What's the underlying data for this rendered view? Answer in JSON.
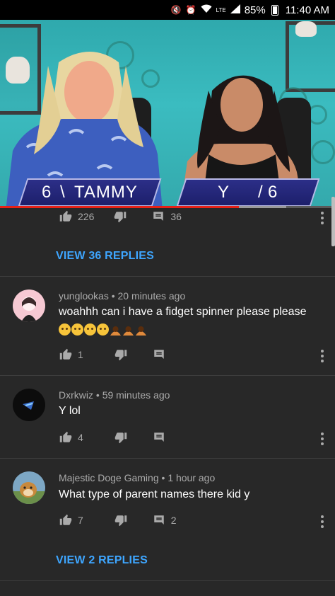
{
  "status_bar": {
    "battery": "85%",
    "time": "11:40 AM",
    "icons": [
      "mute-icon",
      "alarm-icon",
      "wifi-icon",
      "lte-icon",
      "signal-icon",
      "battery-icon"
    ]
  },
  "video": {
    "left_tag": {
      "score": "6",
      "name": "TAMMY"
    },
    "right_tag": {
      "name": "Y",
      "score": "6"
    },
    "progress": 0.713,
    "buffered": 0.854
  },
  "top_actions": {
    "likes": "226",
    "replies": "36"
  },
  "view_replies_1": "VIEW 36 REPLIES",
  "comments": [
    {
      "author": "yunglookas",
      "time": "20 minutes ago",
      "text": "woahhh can i have a fidget spinner please please",
      "emoji": [
        "pleading-face",
        "pleading-face",
        "pleading-face",
        "pleading-face",
        "person-bowing",
        "person-bowing",
        "person-bowing"
      ],
      "likes": "1",
      "replies": ""
    },
    {
      "author": "Dxrkwiz",
      "time": "59 minutes ago",
      "text": "Y lol",
      "likes": "4",
      "replies": ""
    },
    {
      "author": "Majestic Doge Gaming",
      "time": "1 hour ago",
      "text": "What type of parent names there kid y",
      "likes": "7",
      "replies": "2"
    }
  ],
  "view_replies_2": "VIEW 2 REPLIES",
  "colors": {
    "accent": "#3ea6ff",
    "background": "#282828",
    "progress": "#e62117"
  }
}
